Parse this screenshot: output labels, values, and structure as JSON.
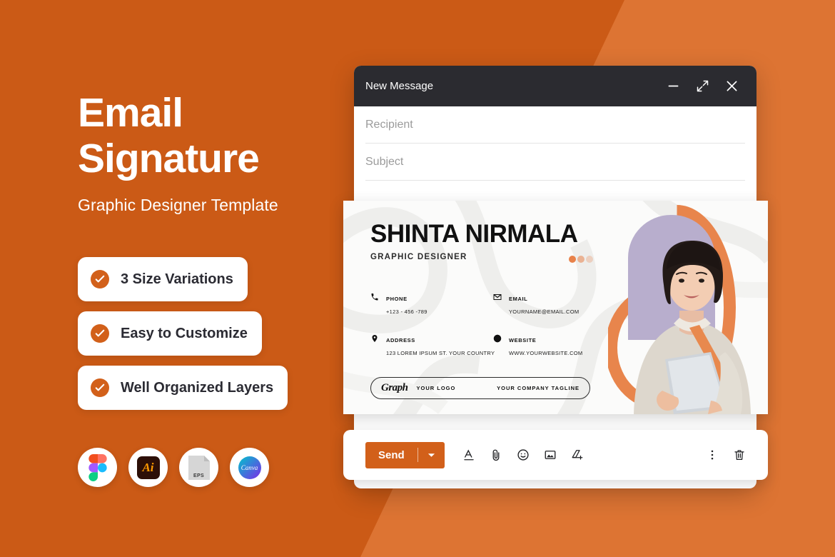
{
  "theme": {
    "bg_orange": "#cb5a16",
    "bg_orange_light": "#dd7433",
    "accent": "#d2601a",
    "titlebar": "#2b2b30"
  },
  "promo": {
    "headline_line1": "Email",
    "headline_line2": "Signature",
    "subtitle": "Graphic Designer Template",
    "features": [
      {
        "label": "3 Size Variations",
        "icon": "check-circle-icon"
      },
      {
        "label": "Easy to Customize",
        "icon": "check-circle-icon"
      },
      {
        "label": "Well Organized Layers",
        "icon": "check-circle-icon"
      }
    ],
    "apps": [
      {
        "name": "figma-icon",
        "label": ""
      },
      {
        "name": "illustrator-icon",
        "label": "Ai"
      },
      {
        "name": "eps-file-icon",
        "label": "EPS"
      },
      {
        "name": "canva-icon",
        "label": "Canva"
      }
    ]
  },
  "email_window": {
    "title": "New Message",
    "controls": [
      {
        "name": "minimize-button",
        "icon": "minus-icon"
      },
      {
        "name": "expand-button",
        "icon": "diagonal-arrows-icon"
      },
      {
        "name": "close-button",
        "icon": "close-icon"
      }
    ],
    "fields": [
      {
        "name": "recipient-field",
        "placeholder": "Recipient",
        "value": ""
      },
      {
        "name": "subject-field",
        "placeholder": "Subject",
        "value": ""
      }
    ],
    "toolbar": {
      "send_label": "Send",
      "send_dropdown_icon": "chevron-down-icon",
      "tools": [
        {
          "name": "formatting-icon",
          "title": "Formatting options"
        },
        {
          "name": "attach-icon",
          "title": "Attach files"
        },
        {
          "name": "emoji-icon",
          "title": "Insert emoji"
        },
        {
          "name": "insert-photo-icon",
          "title": "Insert photo"
        },
        {
          "name": "drive-icon",
          "title": "Insert files using Drive"
        }
      ],
      "right_tools": [
        {
          "name": "more-options-icon",
          "title": "More options"
        },
        {
          "name": "discard-icon",
          "title": "Discard draft"
        }
      ]
    }
  },
  "signature": {
    "name": "SHINTA NIRMALA",
    "role": "GRAPHIC DESIGNER",
    "contacts": [
      {
        "icon": "phone-icon",
        "label": "PHONE",
        "value": "+123 - 456 -789"
      },
      {
        "icon": "email-icon",
        "label": "EMAIL",
        "value": "YOURNAME@EMAIL.COM"
      },
      {
        "icon": "address-icon",
        "label": "ADDRESS",
        "value": "123 LOREM IPSUM ST. YOUR COUNTRY"
      },
      {
        "icon": "website-icon",
        "label": "WEBSITE",
        "value": "WWW.YOURWEBSITE.COM"
      }
    ],
    "logo_bar": {
      "brand": "Graph",
      "logo_text": "YOUR LOGO",
      "tagline": "YOUR COMPANY TAGLINE"
    },
    "portrait_alt": "portrait-photo"
  }
}
